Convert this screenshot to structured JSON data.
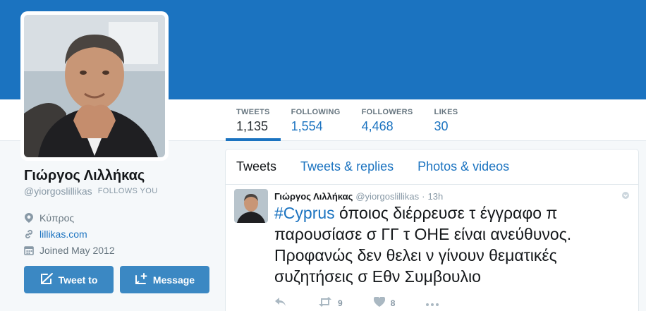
{
  "colors": {
    "banner": "#1b73c0",
    "link": "#1b73c0",
    "button": "#3b88c3"
  },
  "stats": [
    {
      "label": "TWEETS",
      "value": "1,135"
    },
    {
      "label": "FOLLOWING",
      "value": "1,554"
    },
    {
      "label": "FOLLOWERS",
      "value": "4,468"
    },
    {
      "label": "LIKES",
      "value": "30"
    }
  ],
  "profile": {
    "name": "Γιώργος Λιλλήκας",
    "handle": "@yiorgoslillikas",
    "follows_you": "FOLLOWS YOU",
    "location": "Κύπρος",
    "website": "lillikas.com",
    "joined": "Joined May 2012"
  },
  "buttons": {
    "tweet_to": "Tweet to",
    "message": "Message"
  },
  "timeline": {
    "tabs": [
      "Tweets",
      "Tweets & replies",
      "Photos & videos"
    ],
    "tweet": {
      "name": "Γιώργος Λιλλήκας",
      "handle": "@yiorgoslillikas",
      "dot": "·",
      "time": "13h",
      "hashtag": "#Cyprus",
      "text": " όποιος διέρρευσε τ έγγραφο π παρουσίασε σ ΓΓ τ ΟΗΕ είναι ανεύθυνος. Προφανώς δεν θελει ν γίνουν θεματικές συζητήσεις σ Εθν Συμβουλιο",
      "retweets": "9",
      "likes": "8"
    }
  },
  "icons": [
    "location-pin-icon",
    "link-icon",
    "calendar-icon",
    "quill-icon",
    "new-message-icon",
    "reply-icon",
    "retweet-icon",
    "heart-icon",
    "more-icon",
    "caret-icon"
  ]
}
